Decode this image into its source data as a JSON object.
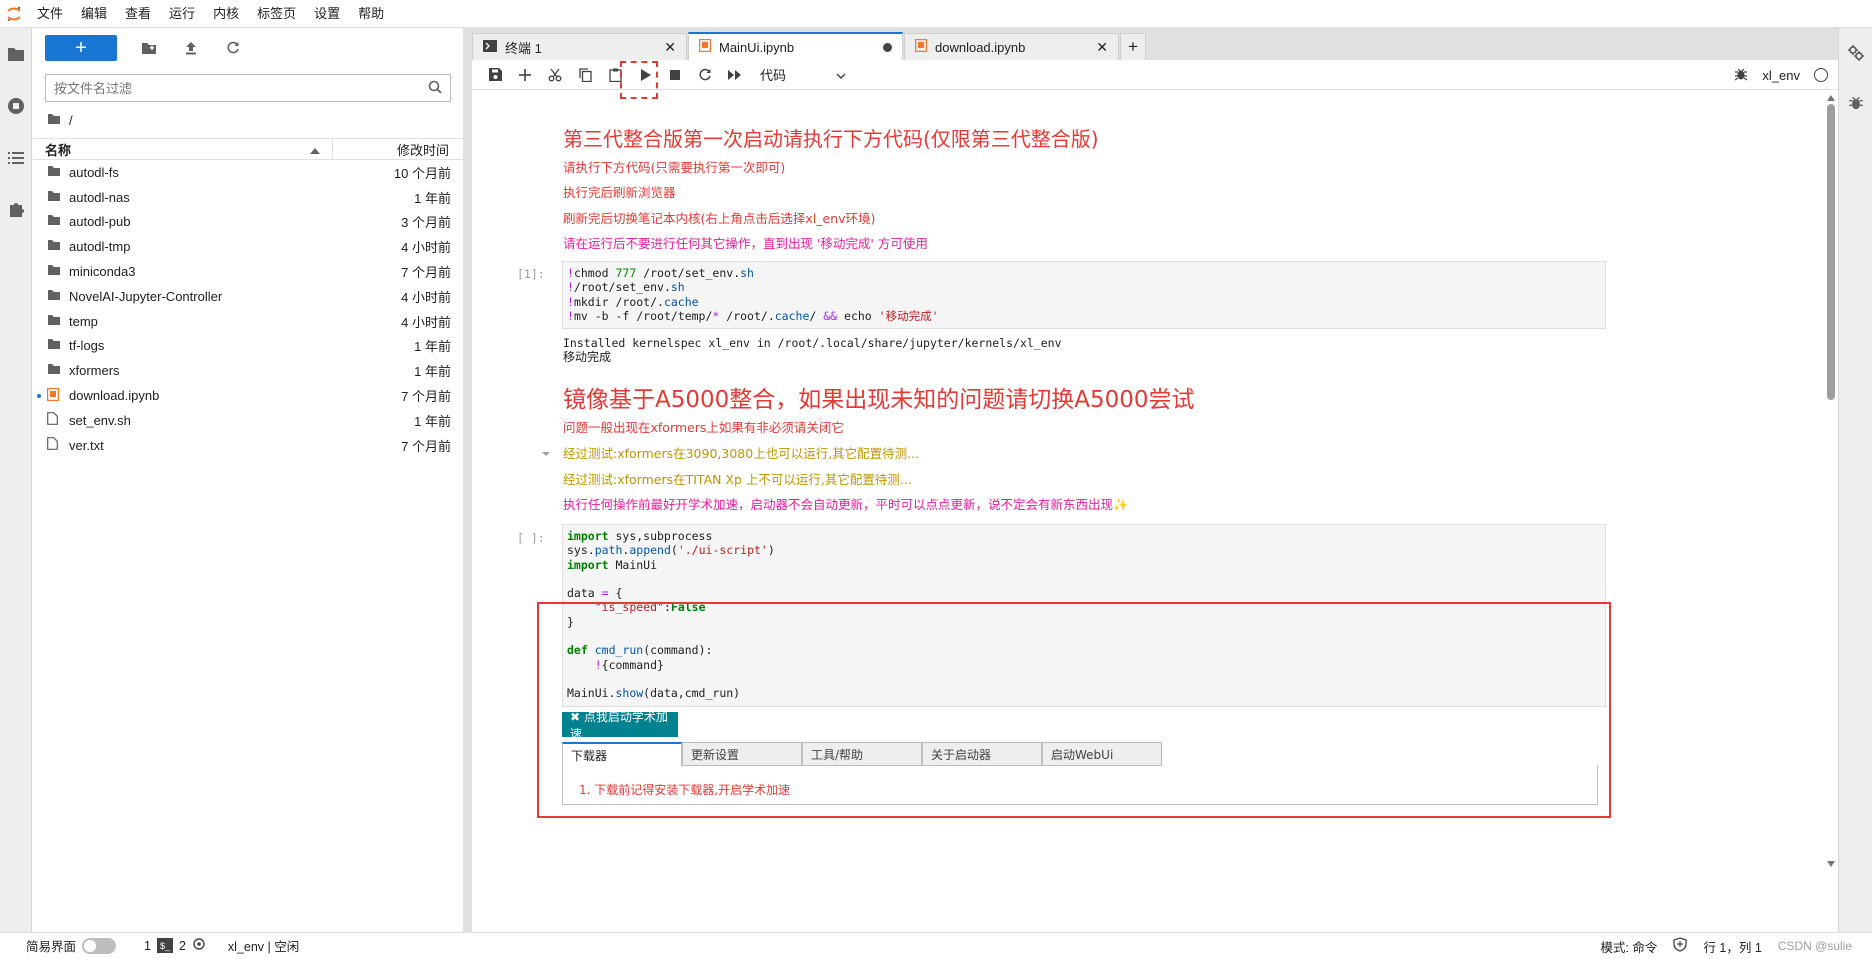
{
  "menubar": {
    "items": [
      "文件",
      "编辑",
      "查看",
      "运行",
      "内核",
      "标签页",
      "设置",
      "帮助"
    ]
  },
  "filebrowser": {
    "new_label": "+",
    "filter_placeholder": "按文件名过滤",
    "breadcrumb": "/",
    "header_name": "名称",
    "header_time": "修改时间",
    "files": [
      {
        "name": "autodl-fs",
        "time": "10 个月前",
        "type": "folder"
      },
      {
        "name": "autodl-nas",
        "time": "1 年前",
        "type": "folder"
      },
      {
        "name": "autodl-pub",
        "time": "3 个月前",
        "type": "folder"
      },
      {
        "name": "autodl-tmp",
        "time": "4 小时前",
        "type": "folder"
      },
      {
        "name": "miniconda3",
        "time": "7 个月前",
        "type": "folder"
      },
      {
        "name": "NovelAI-Jupyter-Controller",
        "time": "4 小时前",
        "type": "folder"
      },
      {
        "name": "temp",
        "time": "4 小时前",
        "type": "folder"
      },
      {
        "name": "tf-logs",
        "time": "1 年前",
        "type": "folder"
      },
      {
        "name": "xformers",
        "time": "1 年前",
        "type": "folder"
      },
      {
        "name": "download.ipynb",
        "time": "7 个月前",
        "type": "notebook"
      },
      {
        "name": "set_env.sh",
        "time": "1 年前",
        "type": "file"
      },
      {
        "name": "ver.txt",
        "time": "7 个月前",
        "type": "file"
      }
    ]
  },
  "tabs": [
    {
      "label": "终端 1",
      "icon": "terminal-icon",
      "active": false
    },
    {
      "label": "MainUi.ipynb",
      "icon": "notebook-icon",
      "active": true
    },
    {
      "label": "download.ipynb",
      "icon": "notebook-icon",
      "active": false
    }
  ],
  "toolbar": {
    "cell_type": "代码",
    "kernel_name": "xl_env"
  },
  "notebook": {
    "md1_title": "第三代整合版第一次启动请执行下方代码(仅限第三代整合版)",
    "md1_l1": "请执行下方代码(只需要执行第一次即可)",
    "md1_l2": "执行完后刷新浏览器",
    "md1_l3": "刷新完后切换笔记本内核(右上角点击后选择xl_env环境)",
    "md1_l4": "请在运行后不要进行任何其它操作，直到出现 '移动完成' 方可使用",
    "cell1_prompt": "[1]:",
    "cell1_output_l1": "Installed kernelspec xl_env in /root/.local/share/jupyter/kernels/xl_env",
    "cell1_output_l2": "移动完成",
    "md2_title": "镜像基于A5000整合，如果出现未知的问题请切换A5000尝试",
    "md2_l1": "问题一般出现在xformers上如果有非必须请关闭它",
    "md2_l2": "经过测试:xformers在3090,3080上也可以运行,其它配置待测...",
    "md2_l3": "经过测试:xformers在TITAN Xp 上不可以运行,其它配置待测...",
    "md2_l4": "执行任何操作前最好开学术加速，启动器不会自动更新，平时可以点点更新，说不定会有新东西出现✨",
    "cell2_prompt": "[ ]:",
    "accel_button": "✖ 点我启动学术加速",
    "widget_tabs": [
      "下载器",
      "更新设置",
      "工具/帮助",
      "关于启动器",
      "启动WebUi"
    ],
    "widget_text": "1. 下载前记得安装下载器,开启学术加速"
  },
  "statusbar": {
    "simple_label": "简易界面",
    "count1": "1",
    "count2": "2",
    "kernel_status": "xl_env | 空闲",
    "mode": "模式: 命令",
    "position": "行 1，列 1",
    "file": "MainUi.ipynb",
    "watermark": "CSDN @sulie"
  }
}
